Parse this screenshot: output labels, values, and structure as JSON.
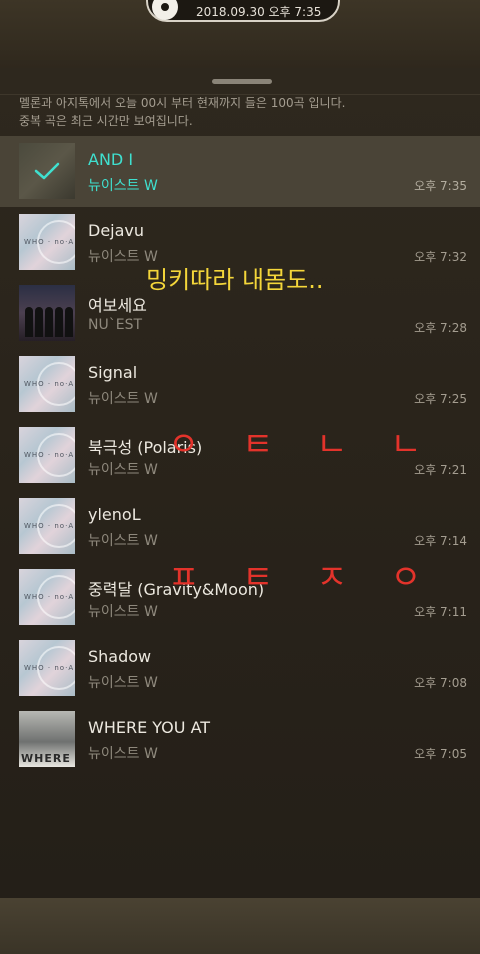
{
  "status": {
    "datetime": "2018.09.30 오후 7:35"
  },
  "sheet": {
    "info_lines": [
      "멜론과 아지톡에서 오늘 00시 부터 현재까지 들은 100곡 입니다.",
      "중복 곡은 최근 시간만 보여집니다."
    ]
  },
  "tracks": [
    {
      "title": "AND I",
      "artist": "뉴이스트 W",
      "time": "오후 7:35",
      "art": "current",
      "playing": true
    },
    {
      "title": "Dejavu",
      "artist": "뉴이스트 W",
      "time": "오후 7:32",
      "art": "who"
    },
    {
      "title": "여보세요",
      "artist": "NU`EST",
      "time": "오후 7:28",
      "art": "group"
    },
    {
      "title": "Signal",
      "artist": "뉴이스트 W",
      "time": "오후 7:25",
      "art": "who"
    },
    {
      "title": "북극성 (Polaris)",
      "artist": "뉴이스트 W",
      "time": "오후 7:21",
      "art": "who"
    },
    {
      "title": "ylenoL",
      "artist": "뉴이스트 W",
      "time": "오후 7:14",
      "art": "who"
    },
    {
      "title": "중력달 (Gravity&Moon)",
      "artist": "뉴이스트 W",
      "time": "오후 7:11",
      "art": "who"
    },
    {
      "title": "Shadow",
      "artist": "뉴이스트 W",
      "time": "오후 7:08",
      "art": "who"
    },
    {
      "title": "WHERE YOU AT",
      "artist": "뉴이스트 W",
      "time": "오후 7:05",
      "art": "where"
    }
  ],
  "album_art_text": {
    "who": "WHO · no·A",
    "where": "WHERE"
  },
  "handwriting": {
    "line1": "밍키따라 내몸도..",
    "line2": "ㅇ ㅌ ㄴ ㄴ",
    "line3": "ㅍ ㅌ ㅈ ㅇ"
  },
  "colors": {
    "accent": "#3fe0cf",
    "handwriting_yellow": "#f4d63a",
    "handwriting_red": "#e3332b"
  }
}
